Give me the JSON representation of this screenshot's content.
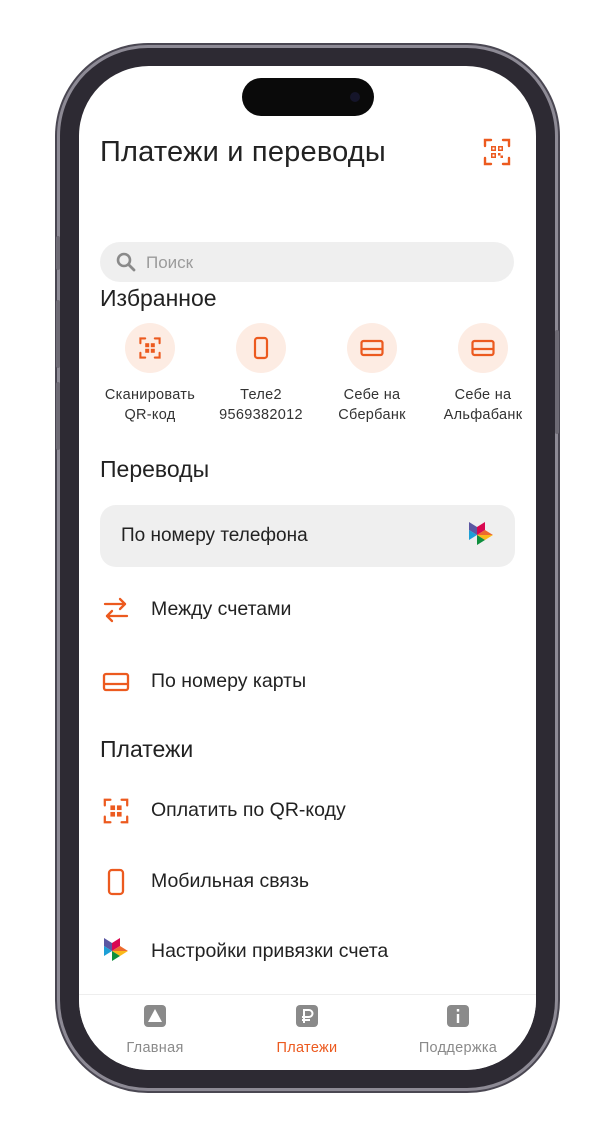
{
  "header": {
    "title": "Платежи и переводы",
    "scan_icon": "qr-scan-icon"
  },
  "search": {
    "placeholder": "Поиск",
    "icon": "search-icon"
  },
  "favorites": {
    "title": "Избранное",
    "items": [
      {
        "label1": "Сканировать",
        "label2": "QR-код",
        "icon": "qr-scan-icon"
      },
      {
        "label1": "Теле2",
        "label2": "9569382012",
        "icon": "mobile-phone-icon"
      },
      {
        "label1": "Себе на",
        "label2": "Сбербанк",
        "icon": "card-icon"
      },
      {
        "label1": "Себе на",
        "label2": "Альфабанк",
        "icon": "card-icon"
      }
    ]
  },
  "transfers": {
    "title": "Переводы",
    "phone_label": "По номеру телефона",
    "between_label": "Между счетами",
    "card_label": "По номеру карты"
  },
  "payments": {
    "title": "Платежи",
    "qr_label": "Оплатить по QR-коду",
    "mobile_label": "Мобильная связь",
    "sbp_settings_label": "Настройки привязки счета"
  },
  "tabs": [
    {
      "label": "Главная",
      "icon": "home-icon",
      "active": false
    },
    {
      "label": "Платежи",
      "icon": "ruble-icon",
      "active": true
    },
    {
      "label": "Поддержка",
      "icon": "info-icon",
      "active": false
    }
  ],
  "colors": {
    "accent": "#ec5a1f",
    "accent_light": "#fdece3",
    "inactive": "#8a8a8a",
    "pill": "#efefef"
  }
}
